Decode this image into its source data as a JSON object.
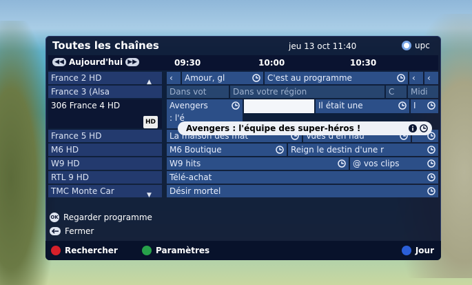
{
  "header": {
    "title": "Toutes les chaînes",
    "datetime": "jeu 13 oct 11:40",
    "brand": "upc"
  },
  "timebar": {
    "day_label": "Aujourd'hui",
    "times": [
      "09:30",
      "10:00",
      "10:30"
    ]
  },
  "channels": [
    {
      "name": "France 2 HD",
      "arrow": "▲"
    },
    {
      "name": "France 3 (Alsa"
    },
    {
      "name": "306  France 4 HD",
      "badge": "HD"
    },
    {
      "name": "France 5 HD"
    },
    {
      "name": "M6 HD"
    },
    {
      "name": "W9 HD"
    },
    {
      "name": "RTL 9 HD"
    },
    {
      "name": "TMC Monte Car",
      "arrow": "▼"
    }
  ],
  "programs": {
    "row0": [
      "Amour, gl",
      "C'est au programme"
    ],
    "row1": [
      "Dans vot",
      "Dans votre région",
      "C",
      "Midi"
    ],
    "row2": [
      "Avengers",
      ": l'é",
      "Il était une",
      "I"
    ],
    "row3": [
      "La maison des mat",
      "Vues d'en hau"
    ],
    "row4": [
      "M6 Boutique",
      "Reign le destin d'une r"
    ],
    "row5": [
      "W9 hits",
      "@ vos clips"
    ],
    "row6": [
      "Télé-achat"
    ],
    "row7": [
      "Désir mortel"
    ]
  },
  "tooltip": {
    "text": "Avengers : l'équipe des super-héros !"
  },
  "actions": {
    "ok_key": "OK",
    "watch_label": "Regarder programme",
    "close_label": "Fermer"
  },
  "bottom": {
    "red_label": "Rechercher",
    "green_label": "Paramètres",
    "blue_label": "Jour"
  },
  "colors": {
    "red": "#d6202a",
    "green": "#27a14a",
    "blue": "#2b5fd8"
  }
}
